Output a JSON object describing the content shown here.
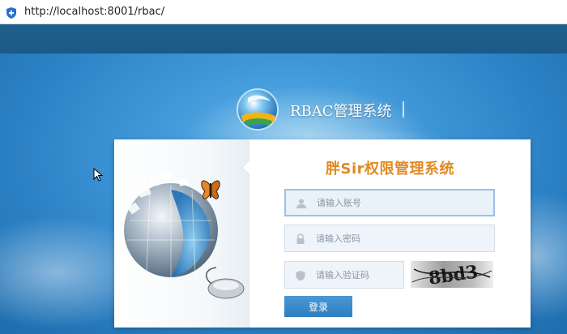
{
  "browser": {
    "url": "http://localhost:8001/rbac/"
  },
  "header": {
    "logo_title": "RBAC管理系统"
  },
  "login": {
    "title": "胖Sir权限管理系统",
    "username_placeholder": "请输入账号",
    "password_placeholder": "请输入密码",
    "captcha_placeholder": "请输入验证码",
    "captcha_text": "8bd3",
    "submit_label": "登录"
  },
  "icons": {
    "address_bar": "shield-icon",
    "username": "user-icon",
    "password": "lock-icon",
    "captcha": "shield-icon",
    "illustration": "globe-puzzle-illustration"
  },
  "colors": {
    "background": "#3f97d8",
    "title_accent": "#e08a23",
    "button": "#2d7fc0"
  }
}
